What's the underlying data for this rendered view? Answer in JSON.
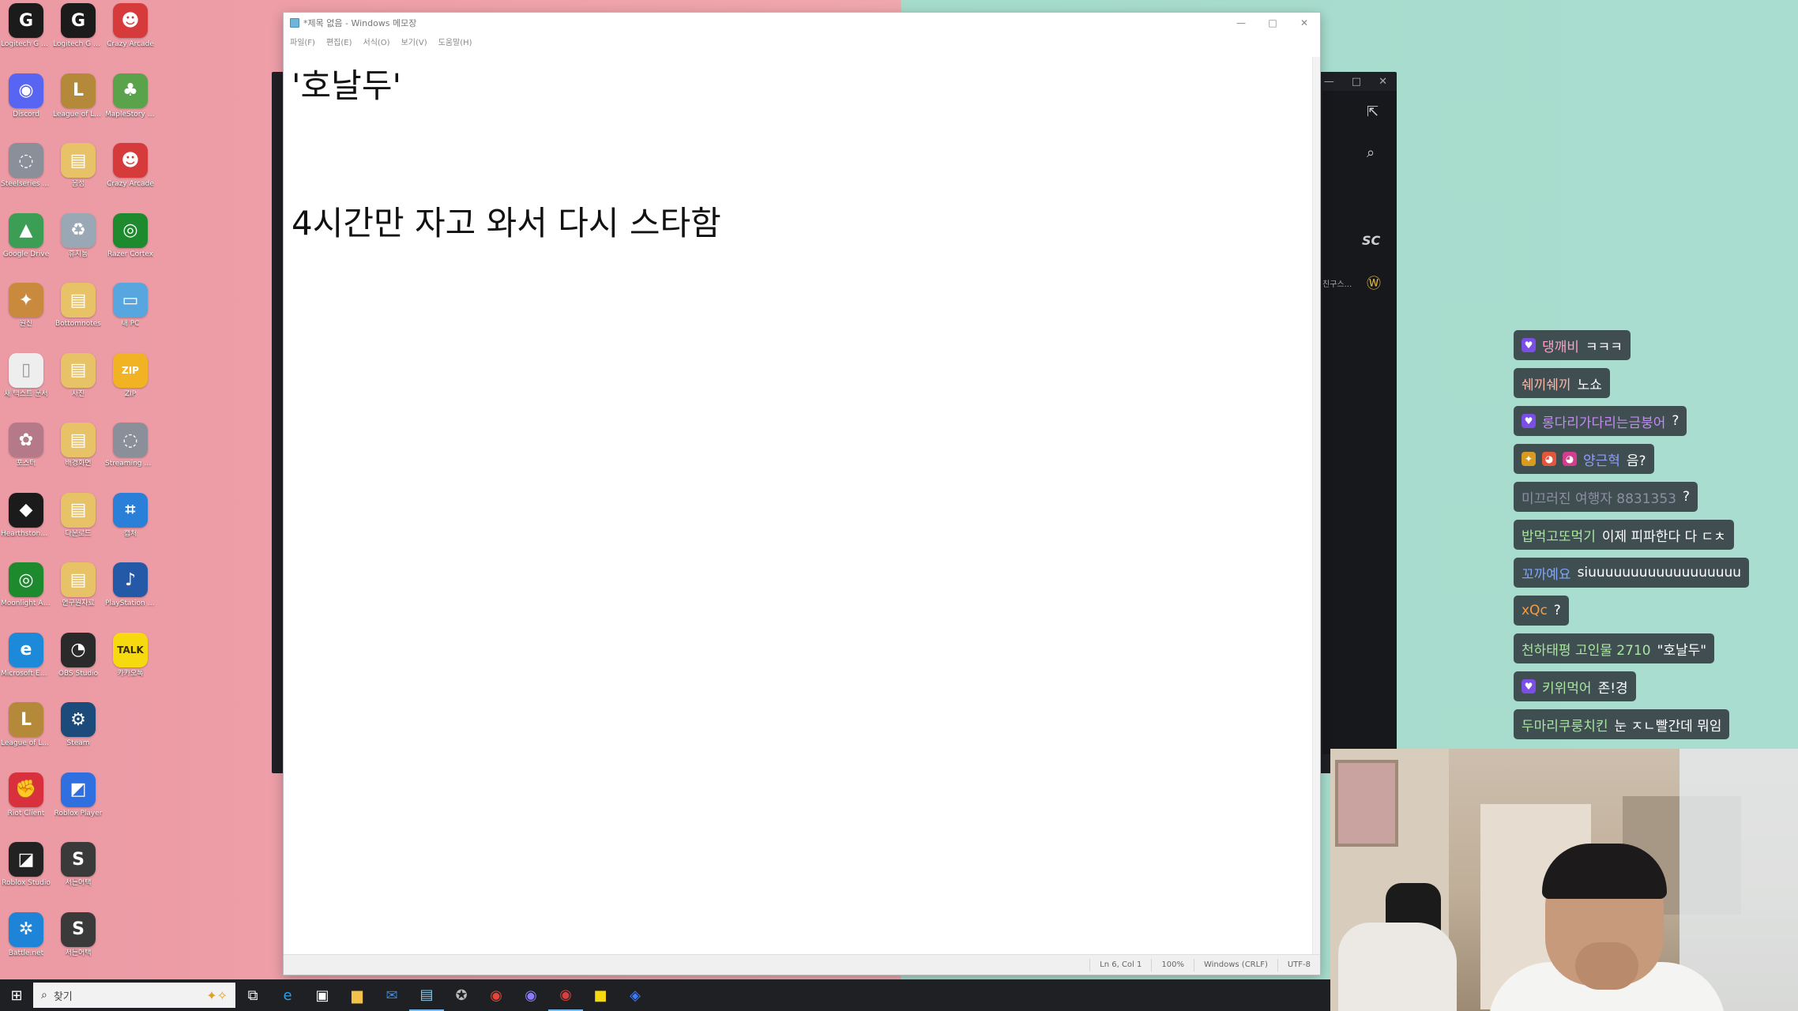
{
  "desktop": {
    "icons": [
      {
        "label": "Logitech G HUB",
        "glyph": "G",
        "color": "#1b1b1b"
      },
      {
        "label": "Logitech G HUB",
        "glyph": "G",
        "color": "#1b1b1b"
      },
      {
        "label": "Crazy Arcade",
        "glyph": "☻",
        "color": "#d63a3a"
      },
      {
        "label": "Discord",
        "glyph": "◉",
        "color": "#5865f2"
      },
      {
        "label": "League of Legends",
        "glyph": "L",
        "color": "#b48a3a"
      },
      {
        "label": "MapleStory Worlds",
        "glyph": "♣",
        "color": "#5aa34a"
      },
      {
        "label": "Steelseries GG",
        "glyph": "◌",
        "color": "#8a8f99"
      },
      {
        "label": "음성",
        "glyph": "▤",
        "color": "#e7c266"
      },
      {
        "label": "Crazy Arcade",
        "glyph": "☻",
        "color": "#d63a3a"
      },
      {
        "label": "Google Drive",
        "glyph": "▲",
        "color": "#3c9d54"
      },
      {
        "label": "휴지통",
        "glyph": "♻",
        "color": "#9aa8b5"
      },
      {
        "label": "Razer Cortex",
        "glyph": "◎",
        "color": "#1d8a2e"
      },
      {
        "label": "원신",
        "glyph": "✦",
        "color": "#c98a3e"
      },
      {
        "label": "Bottomnotes",
        "glyph": "▤",
        "color": "#e7c266"
      },
      {
        "label": "내 PC",
        "glyph": "▭",
        "color": "#58a6e0"
      },
      {
        "label": "새 텍스트 문서",
        "glyph": "▯",
        "color": "#eeeeee"
      },
      {
        "label": "사진",
        "glyph": "▤",
        "color": "#e7c266"
      },
      {
        "label": "ZIP",
        "glyph": "ZIP",
        "color": "#f1b323"
      },
      {
        "label": "포스터",
        "glyph": "✿",
        "color": "#b57a8a"
      },
      {
        "label": "배경화면",
        "glyph": "▤",
        "color": "#e7c266"
      },
      {
        "label": "Streaming Center",
        "glyph": "◌",
        "color": "#8a8f99"
      },
      {
        "label": "Hearthstone Deck Tracker",
        "glyph": "◆",
        "color": "#1b1b1b"
      },
      {
        "label": "다운로드",
        "glyph": "▤",
        "color": "#e7c266"
      },
      {
        "label": "캡처",
        "glyph": "⌗",
        "color": "#2a7fd9"
      },
      {
        "label": "Moonlight App",
        "glyph": "◎",
        "color": "#1d8a2e"
      },
      {
        "label": "연구원자료",
        "glyph": "▤",
        "color": "#e7c266"
      },
      {
        "label": "PlayStation Accessories",
        "glyph": "♪",
        "color": "#2459a8"
      },
      {
        "label": "Microsoft Edge",
        "glyph": "e",
        "color": "#1c8ad8"
      },
      {
        "label": "OBS Studio",
        "glyph": "◔",
        "color": "#2a2a2a"
      },
      {
        "label": "카카오톡",
        "glyph": "TALK",
        "color": "#f6d90f"
      },
      {
        "label": "League of Legends PBE",
        "glyph": "L",
        "color": "#b48a3a"
      },
      {
        "label": "Steam",
        "glyph": "⚙",
        "color": "#1b4b7a"
      },
      {
        "label": "",
        "glyph": "",
        "color": "transparent"
      },
      {
        "label": "Riot Client",
        "glyph": "✊",
        "color": "#d8303d"
      },
      {
        "label": "Roblox Player",
        "glyph": "◩",
        "color": "#2f6fe0"
      },
      {
        "label": "",
        "glyph": "",
        "color": "transparent"
      },
      {
        "label": "Roblox Studio",
        "glyph": "◪",
        "color": "#222222"
      },
      {
        "label": "서든어택",
        "glyph": "S",
        "color": "#3a3a3a"
      },
      {
        "label": "",
        "glyph": "",
        "color": "transparent"
      },
      {
        "label": "Battle.net",
        "glyph": "✲",
        "color": "#1d84d8"
      },
      {
        "label": "서든어택",
        "glyph": "S",
        "color": "#3a3a3a"
      }
    ]
  },
  "notepad": {
    "title": "*제목 없음 - Windows 메모장",
    "menu": [
      "파일(F)",
      "편집(E)",
      "서식(O)",
      "보기(V)",
      "도움말(H)"
    ],
    "lines": [
      "'호날두'",
      "",
      "",
      "4시간만 자고 와서 다시 스타함"
    ],
    "status": {
      "position": "Ln 6, Col 1",
      "zoom": "100%",
      "line_ending": "Windows (CRLF)",
      "encoding": "UTF-8"
    }
  },
  "back_window": {
    "snippet": "친구스..."
  },
  "chat": {
    "messages": [
      {
        "badges": [
          "♥"
        ],
        "badge_color": "#7b4ee6",
        "nick": "댕깨비",
        "nick_color": "#ff9fc4",
        "text": "ㅋㅋㅋ"
      },
      {
        "badges": [],
        "badge_color": "",
        "nick": "쉐끼쉐끼",
        "nick_color": "#ffb3a6",
        "text": "노쇼"
      },
      {
        "badges": [
          "♥"
        ],
        "badge_color": "#7b4ee6",
        "nick": "롱다리가다리는금붕어",
        "nick_color": "#c38af2",
        "text": "?"
      },
      {
        "badges": [
          "✦",
          "◕",
          "◕"
        ],
        "badge_color": "#d89a1f",
        "nick": "양근혁",
        "nick_color": "#8f9dff",
        "text": "음?"
      },
      {
        "badges": [],
        "badge_color": "",
        "nick": "미끄러진 여행자 8831353",
        "nick_color": "#8d8fa3",
        "text": "?"
      },
      {
        "badges": [],
        "badge_color": "",
        "nick": "밥먹고또먹기",
        "nick_color": "#a8e6a0",
        "text": "이제 피파한다 다 ㄷㅊ"
      },
      {
        "badges": [],
        "badge_color": "",
        "nick": "꼬까예요",
        "nick_color": "#7fa6ff",
        "text": "siuuuuuuuuuuuuuuuuuu"
      },
      {
        "badges": [],
        "badge_color": "",
        "nick": "xQc",
        "nick_color": "#ff9a3c",
        "text": "?"
      },
      {
        "badges": [],
        "badge_color": "",
        "nick": "천하태평 고인물 2710",
        "nick_color": "#a8e6a0",
        "text": "\"호날두\""
      },
      {
        "badges": [
          "♥"
        ],
        "badge_color": "#7b4ee6",
        "nick": "키위먹어",
        "nick_color": "#a8e6a0",
        "text": "존!경"
      },
      {
        "badges": [],
        "badge_color": "",
        "nick": "두마리쿠룽치킨",
        "nick_color": "#a8e6a0",
        "text": "눈 ㅈㄴ빨간데 뭐임"
      }
    ]
  },
  "taskbar": {
    "search_placeholder": "찾기",
    "apps": [
      {
        "name": "task-view",
        "glyph": "⧉",
        "color": "#ffffff"
      },
      {
        "name": "edge",
        "glyph": "e",
        "color": "#2aa0e8"
      },
      {
        "name": "store",
        "glyph": "▣",
        "color": "#ffffff"
      },
      {
        "name": "file-explorer",
        "glyph": "▆",
        "color": "#f2c24a"
      },
      {
        "name": "mail",
        "glyph": "✉",
        "color": "#3b86d9"
      },
      {
        "name": "notepad",
        "glyph": "▤",
        "color": "#8ec8e8"
      },
      {
        "name": "app-gear",
        "glyph": "✪",
        "color": "#bbbbbb"
      },
      {
        "name": "chrome",
        "glyph": "◉",
        "color": "#e7453a"
      },
      {
        "name": "discord",
        "glyph": "◉",
        "color": "#8a7cff"
      },
      {
        "name": "obs",
        "glyph": "◉",
        "color": "#d64040"
      },
      {
        "name": "kakaotalk",
        "glyph": "■",
        "color": "#f6d90f"
      },
      {
        "name": "app-blue",
        "glyph": "◈",
        "color": "#3a7cff"
      }
    ]
  }
}
